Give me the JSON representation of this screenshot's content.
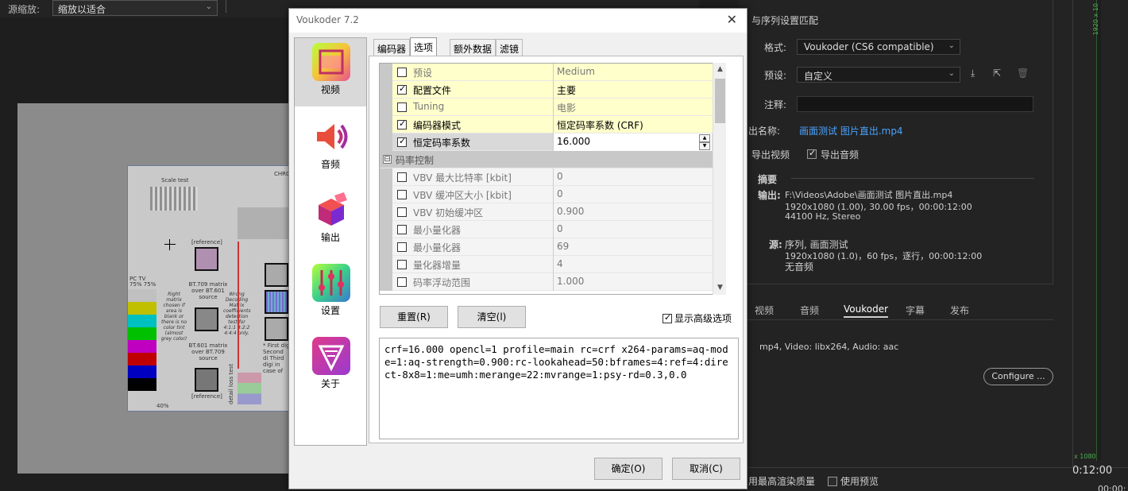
{
  "source_bar": {
    "label": "源缩放:",
    "zoom_value": "缩放以适合"
  },
  "testcard": {
    "scale_test": "Scale test",
    "chro": "CHRO",
    "reference_top": "[reference]",
    "reference_bottom": "[reference]",
    "bt709": "BT.709 matrix over BT.601 source",
    "bt601": "BT.601 matrix over BT.709 source",
    "pc_tv": "PC  TV",
    "pc_tv_pct": "75% 75%",
    "right_matrix": "Right matrix chosen if area is blank or there is no color tint (almost grey color)",
    "wrong_decoding": "Wrong Decoding Matrix coefficients detection test for 4:1:1 4:2:2 4:4:4 only.",
    "first_digit": "* First dig Second di Third digi in case of",
    "detail_loss": "detail loss test",
    "forty": "40%"
  },
  "premiere": {
    "title_partial": "与序列设置匹配",
    "format_label": "格式:",
    "format_value": "Voukoder (CS6 compatible)",
    "preset_label": "预设:",
    "preset_value": "自定义",
    "comment_label": "注释:",
    "output_name_label": "出名称:",
    "output_name_value": "画面测试 图片直出.mp4",
    "export_video": "导出视频",
    "export_audio": "导出音频",
    "summary_label": "摘要",
    "output_label": "输出:",
    "output_line1": "F:\\Videos\\Adobe\\画面测试 图片直出.mp4",
    "output_line2": "1920x1080 (1.00), 30.00 fps，00:00:12:00",
    "output_line3": "44100 Hz, Stereo",
    "source_label": "源:",
    "source_line1": "序列, 画面测试",
    "source_line2": "1920x1080 (1.0)，60 fps，逐行，00:00:12:00",
    "source_line3": "无音频",
    "tabs": [
      "视频",
      "音频",
      "Voukoder",
      "字幕",
      "发布"
    ],
    "voukoder_info": "mp4, Video: libx264, Audio: aac",
    "configure": "Configure ...",
    "max_quality": "用最高渲染质量",
    "use_preview": "使用预览",
    "timecode": "0:12:00",
    "timecode2": "00:00:",
    "green_top": "1920 x 10",
    "green_bottom": "x 1080"
  },
  "dialog": {
    "title": "Voukoder 7.2",
    "close": "✕",
    "nav": [
      {
        "label": "视频"
      },
      {
        "label": "音频"
      },
      {
        "label": "输出"
      },
      {
        "label": "设置"
      },
      {
        "label": "关于"
      }
    ],
    "tabs": [
      "编码器",
      "选项",
      "额外数据",
      "滤镜"
    ],
    "options": [
      {
        "name": "预设",
        "value": "Medium",
        "checked": false
      },
      {
        "name": "配置文件",
        "value": "主要",
        "checked": true
      },
      {
        "name": "Tuning",
        "value": "电影",
        "checked": false
      },
      {
        "name": "编码器模式",
        "value": "恒定码率系数 (CRF)",
        "checked": true
      },
      {
        "name": "恒定码率系数",
        "value": "16.000",
        "checked": true
      }
    ],
    "category": "码率控制",
    "expander": "⊟",
    "rate_options": [
      {
        "name": "VBV 最大比特率 [kbit]",
        "value": "0"
      },
      {
        "name": "VBV 缓冲区大小 [kbit]",
        "value": "0"
      },
      {
        "name": "VBV 初始缓冲区",
        "value": "0.900"
      },
      {
        "name": "最小量化器",
        "value": "0"
      },
      {
        "name": "最小量化器",
        "value": "69"
      },
      {
        "name": "量化器增量",
        "value": "4"
      },
      {
        "name": "码率浮动范围",
        "value": "1.000"
      }
    ],
    "reset_button": "重置(R)",
    "clear_button": "清空(l)",
    "show_advanced": "显示高级选项",
    "command_line": "crf=16.000 opencl=1 profile=main rc=crf x264-params=aq-mode=1:aq-strength=0.900:rc-lookahead=50:bframes=4:ref=4:direct-8x8=1:me=umh:merange=22:mvrange=1:psy-rd=0.3,0.0",
    "ok_button": "确定(O)",
    "cancel_button": "取消(C)"
  },
  "colors": {
    "accent_link": "#4aa3ff",
    "yellow_row": "#ffffcc",
    "nav_active": "#d9d9d9"
  }
}
